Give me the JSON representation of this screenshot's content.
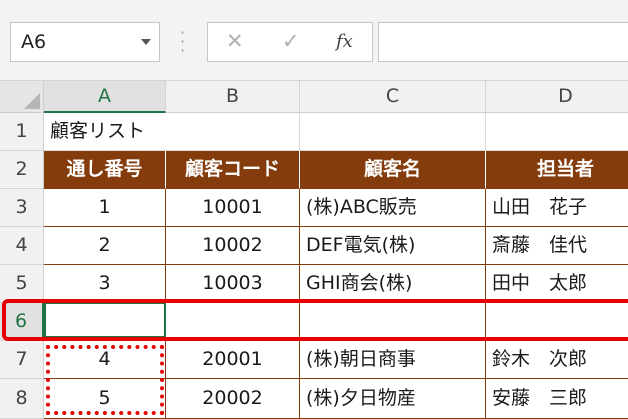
{
  "namebox": {
    "value": "A6"
  },
  "formula_buttons": {
    "cancel": "✕",
    "enter": "✓",
    "fx": "fx"
  },
  "columns": [
    "A",
    "B",
    "C",
    "D"
  ],
  "rows": [
    "1",
    "2",
    "3",
    "4",
    "5",
    "6",
    "7",
    "8"
  ],
  "title": "顧客リスト",
  "headers": [
    "通し番号",
    "顧客コード",
    "顧客名",
    "担当者"
  ],
  "table": [
    [
      "1",
      "10001",
      "(株)ABC販売",
      "山田　花子"
    ],
    [
      "2",
      "10002",
      "DEF電気(株)",
      "斎藤　佳代"
    ],
    [
      "3",
      "10003",
      "GHI商会(株)",
      "田中　太郎"
    ],
    [
      "",
      "",
      "",
      ""
    ],
    [
      "4",
      "20001",
      "(株)朝日商事",
      "鈴木　次郎"
    ],
    [
      "5",
      "20002",
      "(株)夕日物産",
      "安藤　三郎"
    ]
  ],
  "colors": {
    "header_fill": "#843c0c",
    "highlight": "#e60000",
    "selection": "#217346"
  }
}
